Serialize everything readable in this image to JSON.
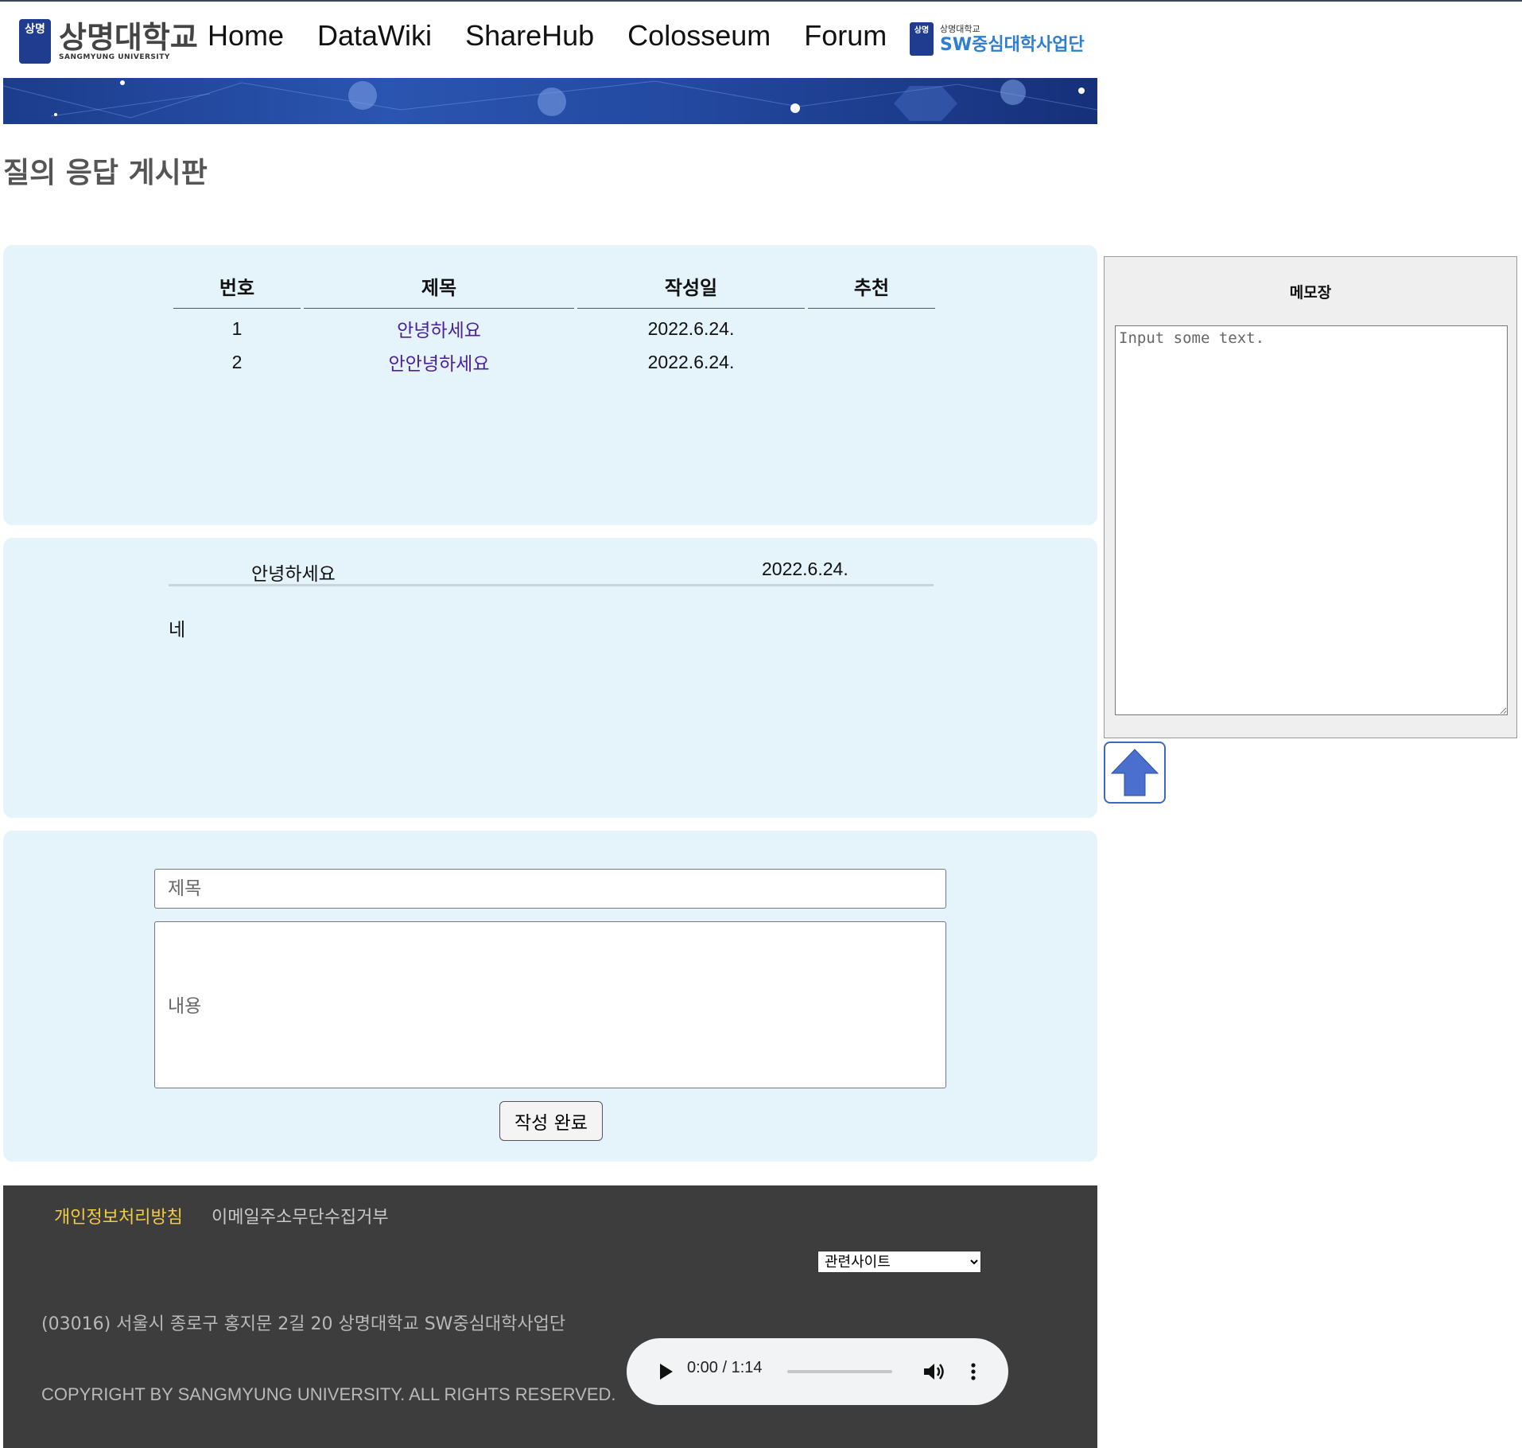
{
  "header": {
    "logo_ko": "상명대학교",
    "logo_en": "SANGMYUNG UNIVERSITY",
    "logo_glyph": "상명",
    "nav": [
      "Home",
      "DataWiki",
      "ShareHub",
      "Colosseum",
      "Forum"
    ],
    "sw_small": "상명대학교",
    "sw_big": "SW중심대학사업단"
  },
  "page_title": "질의 응답 게시판",
  "board": {
    "headers": [
      "번호",
      "제목",
      "작성일",
      "추천"
    ],
    "rows": [
      {
        "no": "1",
        "title": "안녕하세요",
        "date": "2022.6.24.",
        "rec": ""
      },
      {
        "no": "2",
        "title": "안안녕하세요",
        "date": "2022.6.24.",
        "rec": ""
      }
    ]
  },
  "detail": {
    "title": "안녕하세요",
    "date": "2022.6.24.",
    "body": "네"
  },
  "form": {
    "title_placeholder": "제목",
    "body_placeholder": "내용",
    "submit_label": "작성 완료"
  },
  "memo": {
    "title": "메모장",
    "placeholder": "Input some text."
  },
  "footer": {
    "privacy": "개인정보처리방침",
    "email_refuse": "이메일주소무단수집거부",
    "related_sites": "관련사이트",
    "address": "(03016) 서울시 종로구 홍지문 2길 20 상명대학교 SW중심대학사업단",
    "copyright": "COPYRIGHT BY SANGMYUNG UNIVERSITY. ALL RIGHTS RESERVED."
  },
  "audio": {
    "time": "0:00 / 1:14",
    "progress": 0
  },
  "colors": {
    "panel_bg": "#e5f3fa",
    "footer_bg": "#3d3d3d",
    "link_purple": "#4a1f9a",
    "footer_highlight": "#f2cb44",
    "brand_blue": "#1f3c8f",
    "scroll_top_blue": "#4a6fcf"
  },
  "icons": {
    "scroll_top": "arrow-up-icon",
    "play": "play-icon",
    "volume": "volume-icon",
    "more": "more-vertical-icon"
  }
}
